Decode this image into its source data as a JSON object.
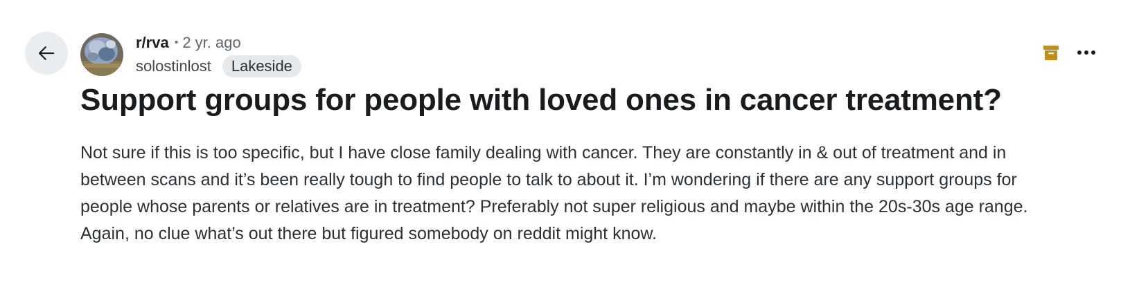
{
  "post": {
    "subreddit": "r/rva",
    "separator": "•",
    "age": "2 yr. ago",
    "author": "solostinlost",
    "flair": "Lakeside",
    "title": "Support groups for people with loved ones in cancer treatment?",
    "body": "Not sure if this is too specific, but I have close family dealing with cancer. They are constantly in & out of treatment and in between scans and it’s been really tough to find people to talk to about it. I’m wondering if there are any support groups for people whose parents or relatives are in treatment? Preferably not super religious and maybe within the 20s-30s age range. Again, no clue what’s out there but figured somebody on reddit might know."
  },
  "icons": {
    "back": "arrow-left-icon",
    "archive": "archive-box-icon",
    "more": "more-horizontal-icon"
  },
  "colors": {
    "archive_icon": "#c28f1a",
    "back_bg": "#eaedef",
    "flair_bg": "#e6e9eb"
  }
}
